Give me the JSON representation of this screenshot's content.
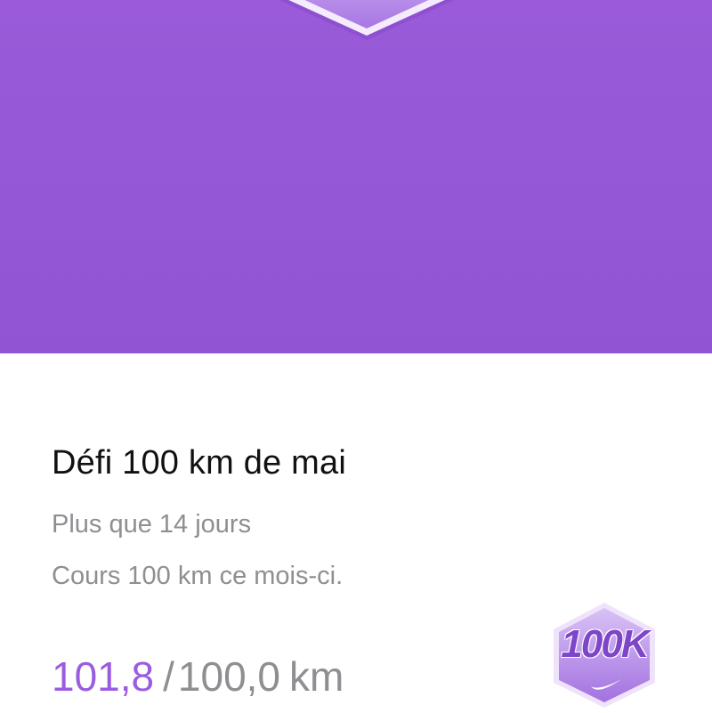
{
  "hero": {
    "background_color": "#9757d6",
    "badge_icon": "hexagon-badge-icon"
  },
  "challenge": {
    "title": "Défi 100 km de mai",
    "remaining": "Plus que 14 jours",
    "description": "Cours 100 km ce mois-ci.",
    "progress": {
      "current": "101,8",
      "separator": "/",
      "target": "100,0",
      "unit": "km"
    },
    "badge": {
      "label": "100K",
      "icon": "swoosh-icon",
      "accent_color": "#9b5de0"
    }
  }
}
